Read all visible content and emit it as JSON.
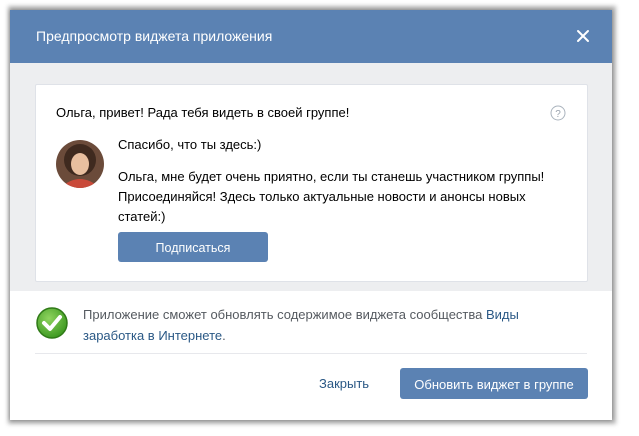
{
  "dialog": {
    "title": "Предпросмотр виджета приложения",
    "close_icon": "close-icon"
  },
  "widget": {
    "title": "Ольга, привет! Рада тебя видеть в своей группе!",
    "help_icon": "help-icon",
    "text_line1": "Спасибо, что ты здесь:)",
    "text_line2": "Ольга, мне будет очень приятно, если ты станешь участником группы! Присоединяйся! Здесь только актуальные новости и анонсы новых статей:)",
    "subscribe_label": "Подписаться"
  },
  "notice": {
    "icon": "check-icon",
    "text": "Приложение сможет обновлять содержимое виджета сообщества ",
    "link": "Виды заработка в Интернете",
    "suffix": "."
  },
  "footer": {
    "close_label": "Закрыть",
    "update_label": "Обновить виджет в группе"
  },
  "colors": {
    "header": "#5b82b3",
    "link": "#2a5885",
    "background": "#edeef0"
  }
}
